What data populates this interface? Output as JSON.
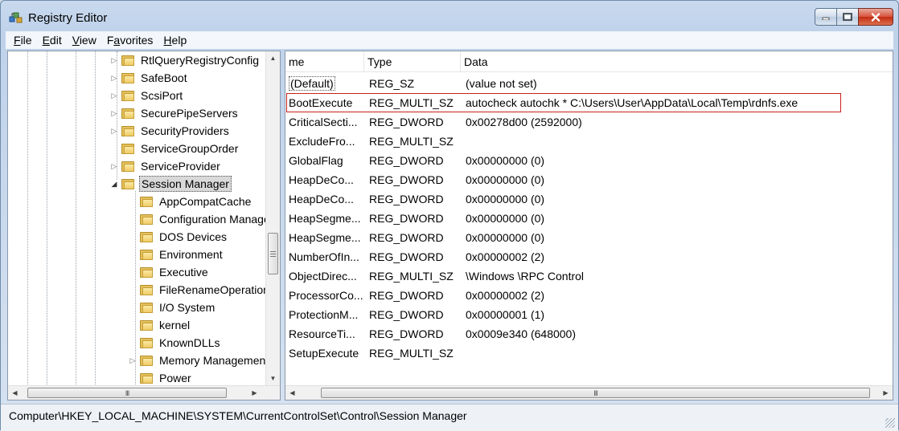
{
  "window": {
    "title": "Registry Editor",
    "icon": "regedit-icon"
  },
  "menu": [
    {
      "label_u": "F",
      "label_rest": "ile"
    },
    {
      "label_u": "E",
      "label_rest": "dit"
    },
    {
      "label_u": "V",
      "label_rest": "iew"
    },
    {
      "label_u": "",
      "label_rest": "Favorites",
      "label_mid_u": "a"
    },
    {
      "label_u": "H",
      "label_rest": "elp"
    }
  ],
  "tree": {
    "items": [
      {
        "label": "RtlQueryRegistryConfig",
        "expander": "collapsed"
      },
      {
        "label": "SafeBoot",
        "expander": "collapsed"
      },
      {
        "label": "ScsiPort",
        "expander": "collapsed"
      },
      {
        "label": "SecurePipeServers",
        "expander": "collapsed"
      },
      {
        "label": "SecurityProviders",
        "expander": "collapsed"
      },
      {
        "label": "ServiceGroupOrder",
        "expander": "none"
      },
      {
        "label": "ServiceProvider",
        "expander": "collapsed"
      },
      {
        "label": "Session Manager",
        "expander": "expanded",
        "selected": true
      },
      {
        "label": "AppCompatCache",
        "expander": "none",
        "child": true
      },
      {
        "label": "Configuration Manager",
        "expander": "none",
        "child": true
      },
      {
        "label": "DOS Devices",
        "expander": "none",
        "child": true
      },
      {
        "label": "Environment",
        "expander": "none",
        "child": true
      },
      {
        "label": "Executive",
        "expander": "none",
        "child": true
      },
      {
        "label": "FileRenameOperations",
        "expander": "none",
        "child": true
      },
      {
        "label": "I/O System",
        "expander": "none",
        "child": true
      },
      {
        "label": "kernel",
        "expander": "none",
        "child": true
      },
      {
        "label": "KnownDLLs",
        "expander": "none",
        "child": true
      },
      {
        "label": "Memory Management",
        "expander": "collapsed",
        "child": true
      },
      {
        "label": "Power",
        "expander": "none",
        "child": true
      }
    ]
  },
  "list": {
    "columns": {
      "name": "me",
      "type": "Type",
      "data": "Data"
    },
    "rows": [
      {
        "name": "(Default)",
        "type": "REG_SZ",
        "data": "(value not set)"
      },
      {
        "name": "BootExecute",
        "type": "REG_MULTI_SZ",
        "data": "autocheck autochk * C:\\Users\\User\\AppData\\Local\\Temp\\rdnfs.exe"
      },
      {
        "name": "CriticalSecti...",
        "type": "REG_DWORD",
        "data": "0x00278d00 (2592000)"
      },
      {
        "name": "ExcludeFro...",
        "type": "REG_MULTI_SZ",
        "data": ""
      },
      {
        "name": "GlobalFlag",
        "type": "REG_DWORD",
        "data": "0x00000000 (0)"
      },
      {
        "name": "HeapDeCo...",
        "type": "REG_DWORD",
        "data": "0x00000000 (0)"
      },
      {
        "name": "HeapDeCo...",
        "type": "REG_DWORD",
        "data": "0x00000000 (0)"
      },
      {
        "name": "HeapSegme...",
        "type": "REG_DWORD",
        "data": "0x00000000 (0)"
      },
      {
        "name": "HeapSegme...",
        "type": "REG_DWORD",
        "data": "0x00000000 (0)"
      },
      {
        "name": "NumberOfIn...",
        "type": "REG_DWORD",
        "data": "0x00000002 (2)"
      },
      {
        "name": "ObjectDirec...",
        "type": "REG_MULTI_SZ",
        "data": "\\Windows \\RPC Control"
      },
      {
        "name": "ProcessorCo...",
        "type": "REG_DWORD",
        "data": "0x00000002 (2)"
      },
      {
        "name": "ProtectionM...",
        "type": "REG_DWORD",
        "data": "0x00000001 (1)"
      },
      {
        "name": "ResourceTi...",
        "type": "REG_DWORD",
        "data": "0x0009e340 (648000)"
      },
      {
        "name": "SetupExecute",
        "type": "REG_MULTI_SZ",
        "data": ""
      }
    ],
    "highlight_color": "#c8201a"
  },
  "statusbar": {
    "path": "Computer\\HKEY_LOCAL_MACHINE\\SYSTEM\\CurrentControlSet\\Control\\Session Manager"
  },
  "scroll_glyphs": {
    "grip": "III"
  }
}
